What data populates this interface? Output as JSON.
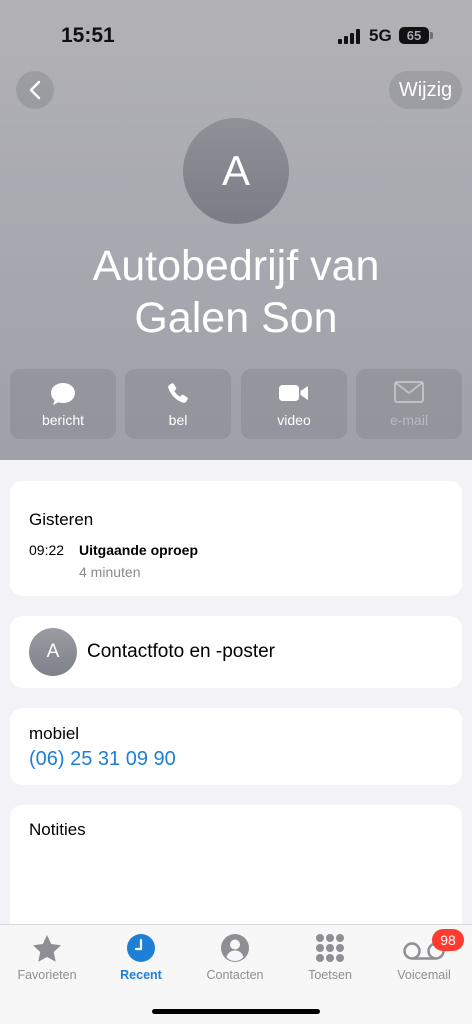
{
  "status_bar": {
    "time": "15:51",
    "network": "5G",
    "battery": "65"
  },
  "header": {
    "edit_label": "Wijzig",
    "avatar_initial": "A",
    "contact_name_line1": "Autobedrijf van",
    "contact_name_line2": "Galen Son"
  },
  "actions": [
    {
      "label": "bericht",
      "icon": "message-bubble-icon"
    },
    {
      "label": "bel",
      "icon": "phone-icon"
    },
    {
      "label": "video",
      "icon": "video-camera-icon"
    },
    {
      "label": "e-mail",
      "icon": "mail-icon",
      "disabled": true
    }
  ],
  "recent": {
    "day": "Gisteren",
    "time": "09:22",
    "type": "Uitgaande oproep",
    "duration": "4 minuten"
  },
  "poster": {
    "initial": "A",
    "label": "Contactfoto en -poster"
  },
  "phone": {
    "type": "mobiel",
    "number": "(06) 25 31 09 90",
    "color": "#1f7fd6"
  },
  "notes": {
    "label": "Notities"
  },
  "tab_bar": {
    "tabs": [
      {
        "label": "Favorieten",
        "icon": "star-icon"
      },
      {
        "label": "Recent",
        "icon": "clock-icon",
        "active": true
      },
      {
        "label": "Contacten",
        "icon": "person-icon"
      },
      {
        "label": "Toetsen",
        "icon": "keypad-icon"
      },
      {
        "label": "Voicemail",
        "icon": "voicemail-icon"
      }
    ],
    "voicemail_badge": "98",
    "accent_color": "#1f7fd6",
    "badge_color": "#ff3b30"
  }
}
